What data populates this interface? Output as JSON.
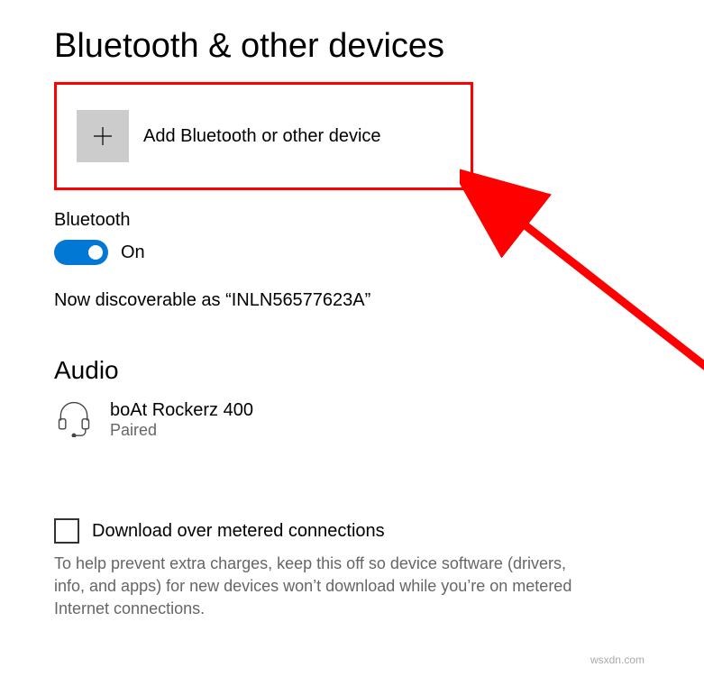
{
  "page": {
    "title": "Bluetooth & other devices"
  },
  "addDevice": {
    "label": "Add Bluetooth or other device"
  },
  "bluetooth": {
    "label": "Bluetooth",
    "state": "On",
    "discoverable": "Now discoverable as “INLN56577623A”"
  },
  "audio": {
    "header": "Audio",
    "device": {
      "name": "boAt Rockerz 400",
      "status": "Paired"
    }
  },
  "metered": {
    "label": "Download over metered connections",
    "help": "To help prevent extra charges, keep this off so device software (drivers, info, and apps) for new devices won’t download while you’re on metered Internet connections."
  },
  "watermark": "wsxdn.com"
}
